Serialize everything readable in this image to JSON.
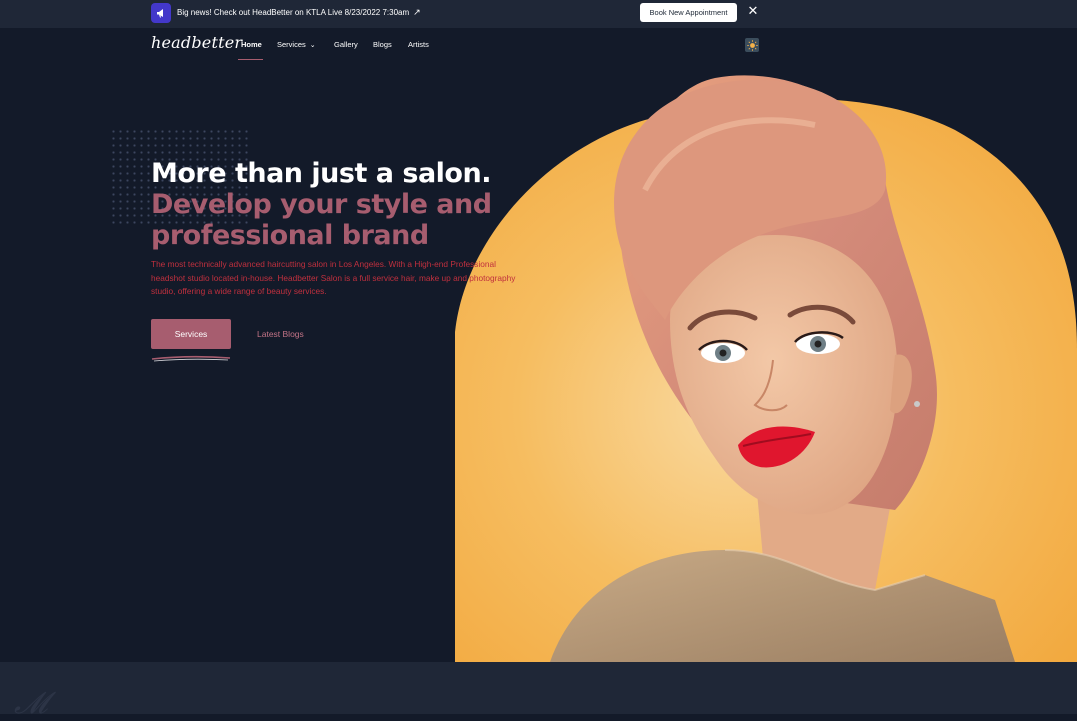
{
  "announcement": {
    "icon": "megaphone-icon",
    "text": "Big news! Check out HeadBetter on KTLA Live 8/23/2022 7:30am",
    "arrow": "↗",
    "cta_label": "Book New Appointment",
    "close_glyph": "✕"
  },
  "nav": {
    "logo": "headbetter",
    "items": [
      {
        "label": "Home",
        "active": true
      },
      {
        "label": "Services",
        "has_dropdown": true
      },
      {
        "label": "Gallery"
      },
      {
        "label": "Blogs"
      },
      {
        "label": "Artists"
      }
    ],
    "dropdown_glyph": "⌄",
    "theme_icon": "sun-icon"
  },
  "hero": {
    "headline": "More than just a salon.",
    "subheadline_line1": "Develop your style and",
    "subheadline_line2": "professional brand",
    "description": "The most technically advanced haircutting salon in Los Angeles. With a High-end Professional headshot studio located in-house. Headbetter Salon is a full service hair, make up and photography studio, offering a wide range of beauty services.",
    "primary_button": "Services",
    "secondary_link": "Latest Blogs",
    "image": "portrait-woman-pink-hair"
  },
  "colors": {
    "background": "#131a29",
    "bar": "#1f2737",
    "accent": "#a75d6f",
    "description_text": "#c0303e",
    "blob": "#f5b24a",
    "announce_icon_bg": "#4338ca"
  }
}
